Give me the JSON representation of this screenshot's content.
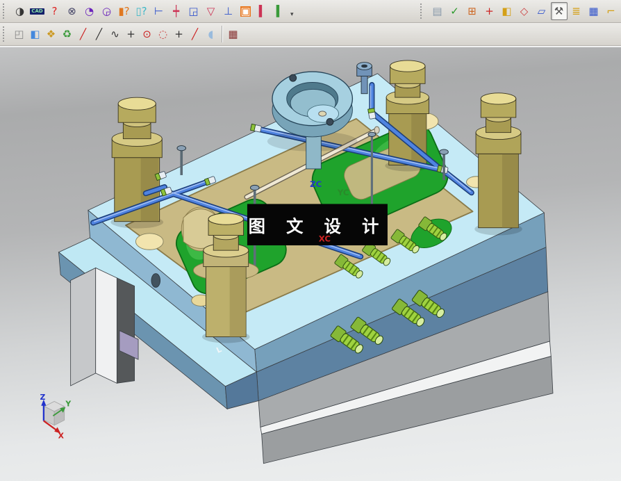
{
  "toolbars": {
    "overflow_glyph": "▾",
    "row1_left": [
      {
        "name": "mold-wizard",
        "glyph": "◑",
        "fg": "#333333"
      },
      {
        "name": "cad-init",
        "glyph": "CAD",
        "fg": "#88e0a8",
        "bg": "#14206a"
      },
      {
        "name": "design-part",
        "glyph": "?",
        "fg": "#dd2222"
      },
      {
        "name": "mold-csys",
        "glyph": "⊗",
        "fg": "#444466"
      },
      {
        "name": "shrinkage",
        "glyph": "◔",
        "fg": "#6a22bb"
      },
      {
        "name": "workpiece",
        "glyph": "◶",
        "fg": "#6a22bb"
      },
      {
        "name": "standard-part",
        "glyph": "▮?",
        "fg": "#e07820"
      },
      {
        "name": "ejector-pin",
        "glyph": "▯?",
        "fg": "#3fb8c8"
      },
      {
        "name": "slide-lifter",
        "glyph": "⊢",
        "fg": "#3355cc"
      },
      {
        "name": "insert-pin",
        "glyph": "┿",
        "fg": "#cc3355"
      },
      {
        "name": "corner-piece",
        "glyph": "◲",
        "fg": "#3355cc"
      },
      {
        "name": "gate-design",
        "glyph": "▽",
        "fg": "#cc3355"
      },
      {
        "name": "runner-design",
        "glyph": "⊥",
        "fg": "#3355cc"
      },
      {
        "name": "mold-cool",
        "glyph": "▣",
        "fg": "#ffffff",
        "bg": "#e87820"
      },
      {
        "name": "pin-red",
        "glyph": "▍",
        "fg": "#cc3355"
      },
      {
        "name": "pin-green",
        "glyph": "▍",
        "fg": "#3a9a3a"
      }
    ],
    "row1_right": [
      {
        "name": "new-part",
        "glyph": "▤",
        "fg": "#8899aa"
      },
      {
        "name": "validate",
        "glyph": "✓",
        "fg": "#2a9a2a"
      },
      {
        "name": "mold-layout",
        "glyph": "⊞",
        "fg": "#cc6622"
      },
      {
        "name": "wcs-triad",
        "glyph": "+",
        "fg": "#cc2222"
      },
      {
        "name": "workpiece-box",
        "glyph": "◧",
        "fg": "#d4a017"
      },
      {
        "name": "cavity-surface",
        "glyph": "◇",
        "fg": "#cc4444"
      },
      {
        "name": "parting-tool",
        "glyph": "▱",
        "fg": "#3355cc"
      },
      {
        "name": "mold-tools",
        "glyph": "⚒",
        "fg": "#555555",
        "active": true
      },
      {
        "name": "mold-stack",
        "glyph": "≣",
        "fg": "#d4a017"
      },
      {
        "name": "view-manager",
        "glyph": "▦",
        "fg": "#3355cc"
      },
      {
        "name": "unload-tool",
        "glyph": "⌐",
        "fg": "#d4a017"
      }
    ],
    "row2_left": [
      {
        "name": "extruded-solid",
        "glyph": "◰",
        "fg": "#888888"
      },
      {
        "name": "bounded-box",
        "glyph": "◧",
        "fg": "#4488dd"
      },
      {
        "name": "pocket-pattern",
        "glyph": "❖",
        "fg": "#cc9922"
      },
      {
        "name": "reuse-library",
        "glyph": "♻",
        "fg": "#3a9a3a"
      },
      {
        "name": "line-tool",
        "glyph": "╱",
        "fg": "#cc2222"
      },
      {
        "name": "line-tool-2",
        "glyph": "╱",
        "fg": "#333333"
      },
      {
        "name": "spline-tool",
        "glyph": "∿",
        "fg": "#333333"
      },
      {
        "name": "point-tool",
        "glyph": "+",
        "fg": "#333333"
      },
      {
        "name": "circle-center",
        "glyph": "⊙",
        "fg": "#cc2222"
      },
      {
        "name": "circle-points",
        "glyph": "◌",
        "fg": "#cc4444"
      },
      {
        "name": "cross-hair",
        "glyph": "+",
        "fg": "#333333"
      },
      {
        "name": "line-point",
        "glyph": "╱",
        "fg": "#cc2222"
      },
      {
        "name": "face-tool",
        "glyph": "◖",
        "fg": "#99bbdd"
      }
    ],
    "row2_right": [
      {
        "name": "grid-editor",
        "glyph": "▦",
        "fg": "#883333"
      }
    ]
  },
  "viewport": {
    "banner": {
      "text": "图 文 设 计",
      "bg": "#060606",
      "fg": "#ffffff"
    },
    "wcs": {
      "zc": "ZC",
      "yc": "YC",
      "xc": "XC",
      "zc_color": "#2438c8",
      "yc_color": "#2a8a2a",
      "xc_color": "#cc2222"
    },
    "triad": {
      "z": "Z",
      "y": "Y",
      "x": "X",
      "z_color": "#2233cc",
      "y_color": "#3a9a3a",
      "x_color": "#cc2222"
    },
    "datum_mark": "L",
    "colors": {
      "top_plate": "#c5eaf6",
      "side_blue": "#76a0bb",
      "b_plate": "#5d82a2",
      "pocket_tan": "#c9ba84",
      "cavity_green": "#1fa32c",
      "pillar_olive": "#b0a459",
      "pipe_blue": "#4f83e0",
      "ring_blue": "#a6d0e0",
      "fitting_green": "#9fd23f",
      "base_gray": "#a8abad"
    }
  }
}
